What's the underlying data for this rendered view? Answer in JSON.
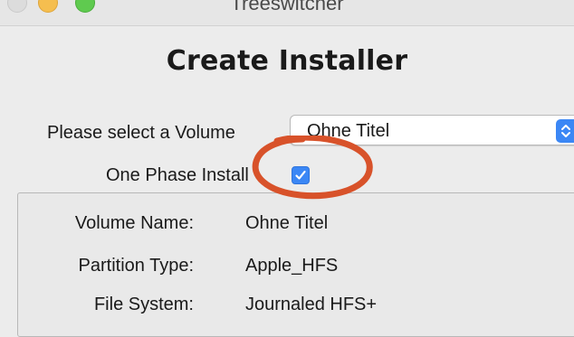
{
  "window": {
    "title": "Treeswitcher"
  },
  "heading": "Create Installer",
  "volume_select": {
    "label": "Please select a Volume",
    "value": "Ohne Titel"
  },
  "one_phase": {
    "label": "One Phase Install",
    "checked": true
  },
  "info": {
    "rows": [
      {
        "label": "Volume Name:",
        "value": "Ohne Titel"
      },
      {
        "label": "Partition Type:",
        "value": "Apple_HFS"
      },
      {
        "label": "File System:",
        "value": "Journaled HFS+"
      }
    ]
  },
  "colors": {
    "accent": "#3b87f5",
    "annotation": "#d8522a",
    "traffic_min": "#f5be4f",
    "traffic_max": "#5fca4f"
  },
  "icons": {
    "stepper": "updown-chevron-icon",
    "checkbox": "checkmark-icon"
  }
}
